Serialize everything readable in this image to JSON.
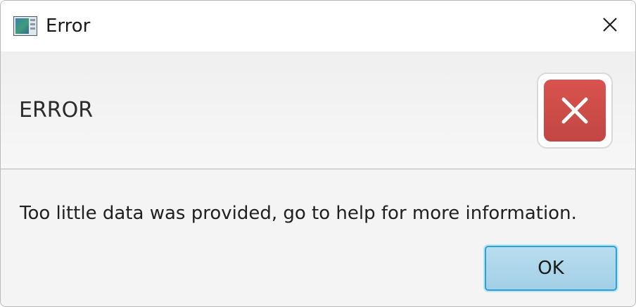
{
  "window": {
    "title": "Error",
    "icon": "app-window-icon",
    "close_icon": "close-icon"
  },
  "dialog": {
    "header_text": "ERROR",
    "graphic_icon": "error-x-icon",
    "graphic_color": "#d9534f",
    "message": "Too little data was provided, go to help for more information.",
    "ok_label": "OK",
    "ok_accent": "#27a3d6"
  }
}
